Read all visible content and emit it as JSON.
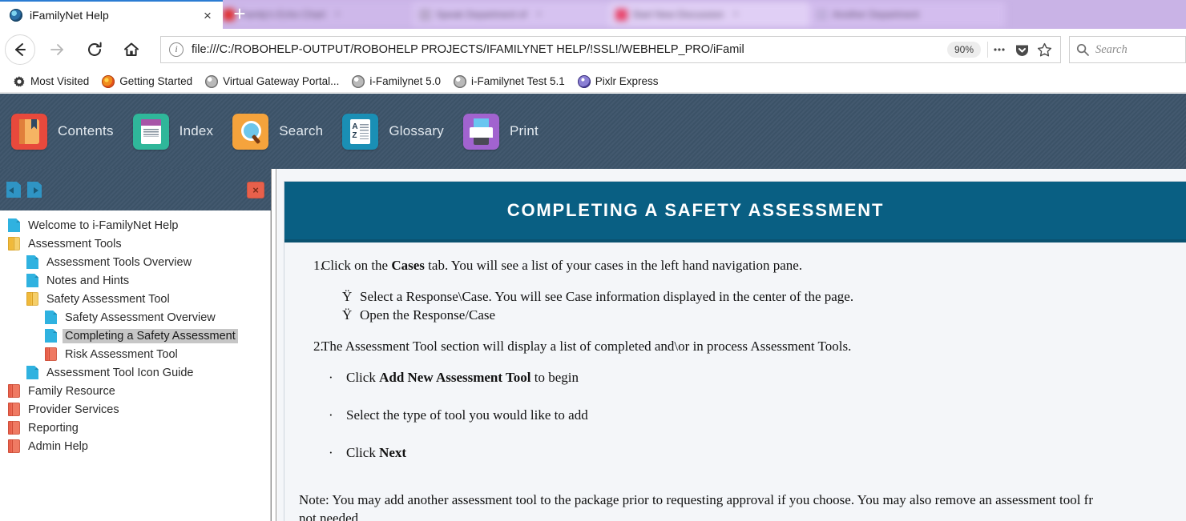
{
  "browser": {
    "active_tab": {
      "title": "iFamilyNet Help",
      "favicon": "globe-favicon",
      "close_label": "×"
    },
    "background_tabs": [
      {
        "title": "Family's Echo Chart",
        "favicon": "red-favicon"
      },
      {
        "title": "Speak Department of",
        "favicon": "gray-favicon"
      },
      {
        "title": "Start New Discussion",
        "favicon": "pink-favicon"
      },
      {
        "title": "Another Department",
        "favicon": "lavender-favicon"
      }
    ],
    "new_tab_label": "+",
    "nav": {
      "back": "back-arrow-icon",
      "forward": "forward-arrow-icon",
      "reload": "reload-icon",
      "home": "home-icon"
    },
    "url": "file:///C:/ROBOHELP-OUTPUT/ROBOHELP PROJECTS/IFAMILYNET HELP/!SSL!/WEBHELP_PRO/iFamil",
    "zoom_level": "90%",
    "page_actions_label": "•••",
    "search_placeholder": "Search",
    "bookmarks": [
      {
        "label": "Most Visited",
        "icon": "gear-icon"
      },
      {
        "label": "Getting Started",
        "icon": "firefox-icon"
      },
      {
        "label": "Virtual Gateway Portal...",
        "icon": "globe-icon"
      },
      {
        "label": "i-Familynet 5.0",
        "icon": "globe-icon"
      },
      {
        "label": "i-Familynet Test 5.1",
        "icon": "globe-icon"
      },
      {
        "label": "Pixlr Express",
        "icon": "pixlr-icon"
      }
    ]
  },
  "help_toolbar": [
    {
      "label": "Contents",
      "icon": "book-icon"
    },
    {
      "label": "Index",
      "icon": "index-card-icon"
    },
    {
      "label": "Search",
      "icon": "magnifier-icon"
    },
    {
      "label": "Glossary",
      "icon": "az-list-icon"
    },
    {
      "label": "Print",
      "icon": "printer-icon"
    }
  ],
  "sidebar": {
    "prev_topic_label": "prev-topic-icon",
    "next_topic_label": "next-topic-icon",
    "close_label": "×",
    "tree": [
      {
        "label": "Welcome to i-FamilyNet Help",
        "icon": "page",
        "level": 0,
        "selected": false
      },
      {
        "label": "Assessment Tools",
        "icon": "book",
        "level": 0,
        "selected": false
      },
      {
        "label": "Assessment Tools Overview",
        "icon": "page",
        "level": 1,
        "selected": false
      },
      {
        "label": "Notes and Hints",
        "icon": "page",
        "level": 1,
        "selected": false
      },
      {
        "label": "Safety Assessment Tool",
        "icon": "book",
        "level": 1,
        "selected": false
      },
      {
        "label": "Safety Assessment Overview",
        "icon": "page",
        "level": 2,
        "selected": false
      },
      {
        "label": "Completing a Safety Assessment",
        "icon": "page",
        "level": 2,
        "selected": true
      },
      {
        "label": "Risk Assessment Tool",
        "icon": "bookred",
        "level": 2,
        "selected": false
      },
      {
        "label": "Assessment Tool Icon Guide",
        "icon": "page",
        "level": 1,
        "selected": false
      },
      {
        "label": "Family Resource",
        "icon": "bookred",
        "level": 0,
        "selected": false
      },
      {
        "label": "Provider Services",
        "icon": "bookred",
        "level": 0,
        "selected": false
      },
      {
        "label": "Reporting",
        "icon": "bookred",
        "level": 0,
        "selected": false
      },
      {
        "label": "Admin Help",
        "icon": "bookred",
        "level": 0,
        "selected": false
      }
    ]
  },
  "topic": {
    "banner_title": "COMPLETING A SAFETY ASSESSMENT",
    "banner_color": "#095f83",
    "step1": {
      "number": "1.",
      "text_a": "Click on the ",
      "bold_a": "Cases",
      "text_b": " tab.  You will see a list of your cases in the left hand navigation pane.",
      "bullets": [
        {
          "marker": "Ÿ",
          "text": "Select a Response\\Case.  You will see Case information displayed in the center of the page."
        },
        {
          "marker": "Ÿ",
          "text": "Open the Response/Case"
        }
      ]
    },
    "step2": {
      "number": "2.",
      "text": "The Assessment Tool section will display a list of completed and\\or in process Assessment Tools.",
      "bullets": [
        {
          "marker": "·",
          "pre": "Click ",
          "bold": "Add New Assessment Tool",
          "post": " to begin"
        },
        {
          "marker": "·",
          "pre": "Select the type of tool you would like to add",
          "bold": "",
          "post": ""
        },
        {
          "marker": "·",
          "pre": "Click ",
          "bold": "Next",
          "post": ""
        }
      ]
    },
    "note_line1": "Note:  You may add another assessment tool to the package prior to requesting approval if you choose.  You may also remove an assessment tool fr",
    "note_line2": "not needed."
  }
}
